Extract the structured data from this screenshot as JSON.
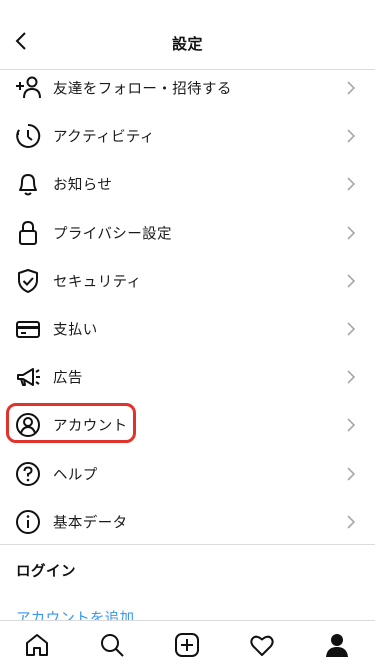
{
  "header": {
    "title": "設定"
  },
  "menu": [
    {
      "label": "友達をフォロー・招待する",
      "icon": "add-person-icon"
    },
    {
      "label": "アクティビティ",
      "icon": "activity-clock-icon"
    },
    {
      "label": "お知らせ",
      "icon": "bell-icon"
    },
    {
      "label": "プライバシー設定",
      "icon": "lock-icon"
    },
    {
      "label": "セキュリティ",
      "icon": "shield-check-icon"
    },
    {
      "label": "支払い",
      "icon": "card-icon"
    },
    {
      "label": "広告",
      "icon": "megaphone-icon"
    },
    {
      "label": "アカウント",
      "icon": "person-circle-icon"
    },
    {
      "label": "ヘルプ",
      "icon": "help-icon"
    },
    {
      "label": "基本データ",
      "icon": "info-icon"
    }
  ],
  "login": {
    "title": "ログイン",
    "add_account": "アカウントを追加"
  },
  "tabbar": [
    "home-icon",
    "search-icon",
    "new-post-icon",
    "heart-icon",
    "profile-icon"
  ],
  "colors": {
    "link": "#3897f0",
    "highlight": "#e0332c",
    "divider": "#dbdbdb"
  }
}
